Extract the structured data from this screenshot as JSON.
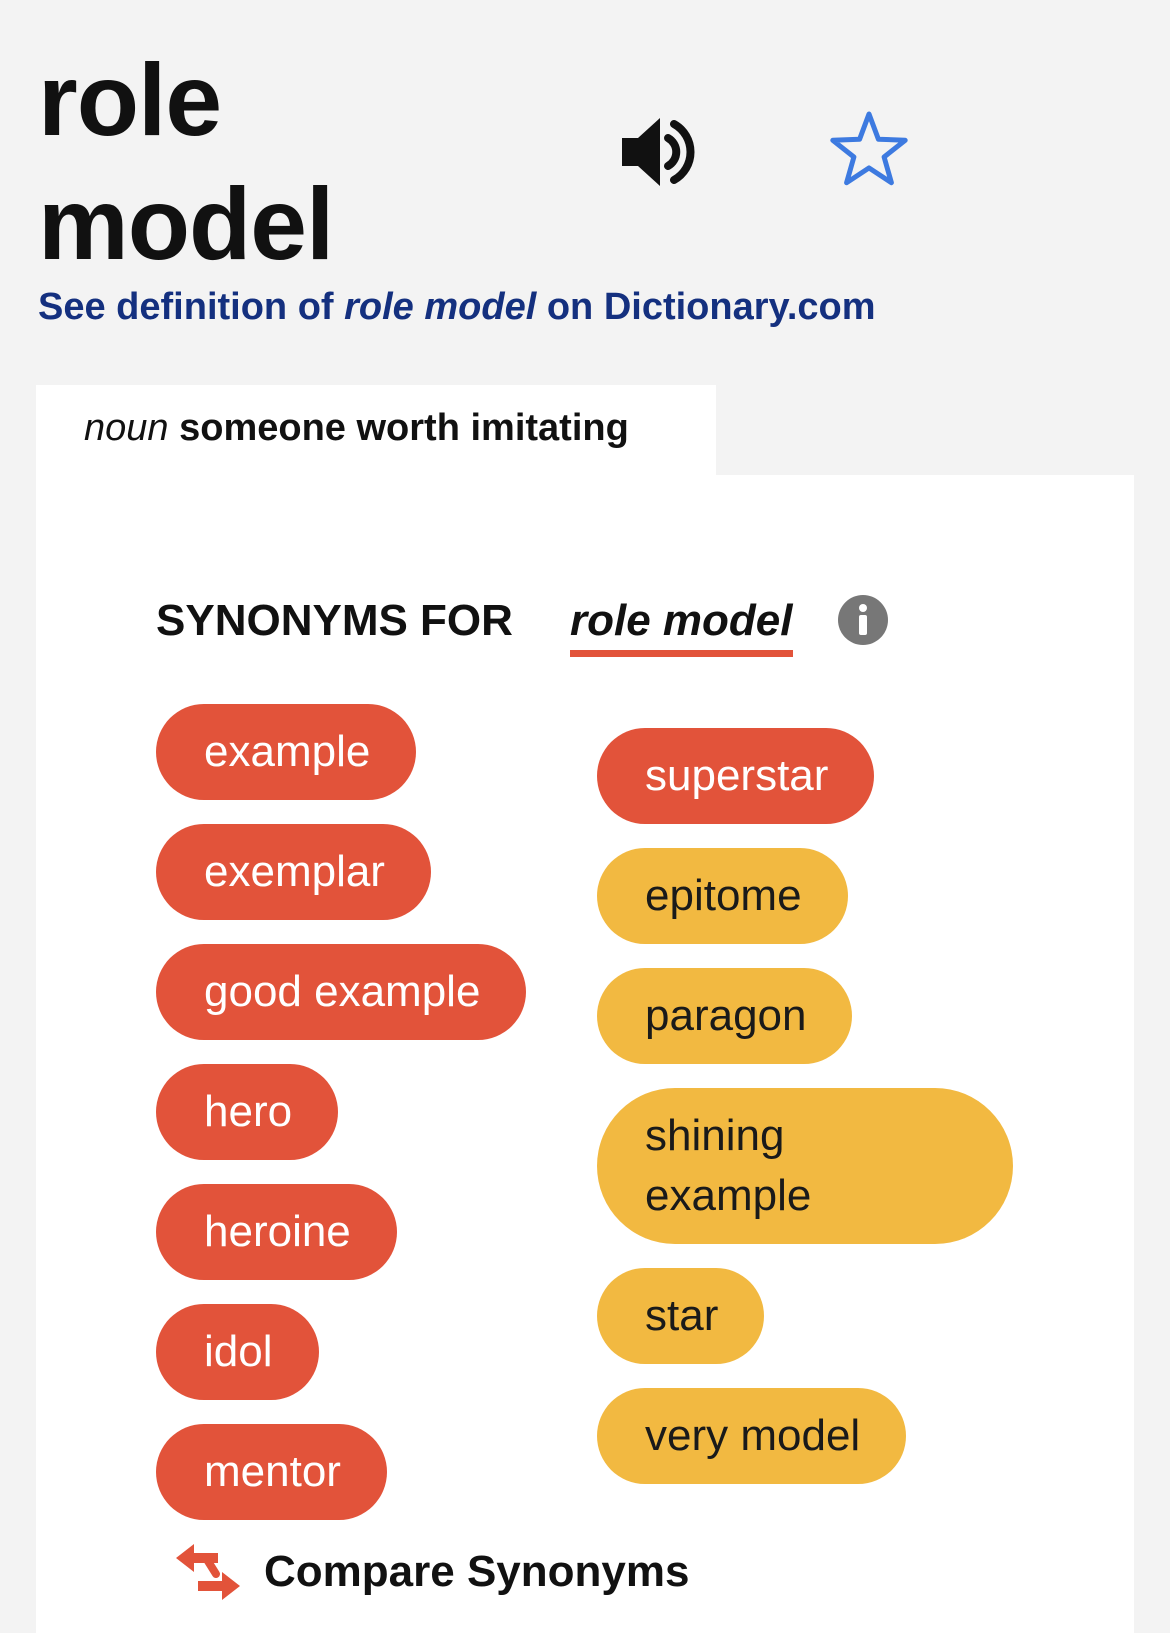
{
  "entry": {
    "headword_line1": "role",
    "headword_line2": "model",
    "speaker_icon": "speaker-icon",
    "favorite_icon": "star-outline-icon"
  },
  "definition_link": {
    "prefix": "See definition of ",
    "term": "role model",
    "suffix": " on Dictionary.com"
  },
  "sense_tab": {
    "part_of_speech": "noun",
    "sense": " someone worth imitating"
  },
  "synonyms": {
    "heading": "SYNONYMS FOR",
    "word": "role model",
    "info_icon": "info-icon",
    "strongest_color": "#e2533a",
    "strong_color": "#f2b941",
    "left_column": [
      "example",
      "exemplar",
      "good example",
      "hero",
      "heroine",
      "idol",
      "mentor"
    ],
    "right_column_strongest": [
      "superstar"
    ],
    "right_column_strong": [
      "epitome",
      "paragon",
      "shining example",
      "star",
      "very model"
    ]
  },
  "compare": {
    "label": "Compare Synonyms",
    "icon": "compare-arrows-icon"
  }
}
